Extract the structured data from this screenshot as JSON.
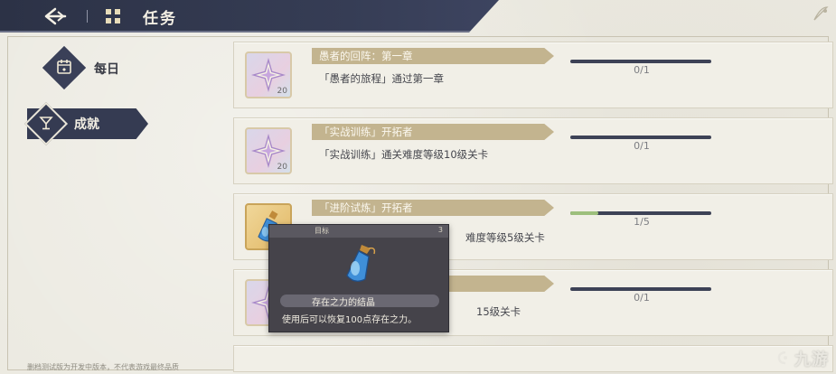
{
  "header": {
    "title": "任务",
    "back_icon": "back-arrow-icon",
    "task_icon": "task-grid-icon"
  },
  "nav": {
    "items": [
      {
        "label": "每日",
        "icon": "calendar-icon",
        "selected": false
      },
      {
        "label": "成就",
        "icon": "cup-icon",
        "selected": true
      }
    ]
  },
  "tasks": [
    {
      "title": "愚者的回阵：第一章",
      "desc": "「愚者的旅程」通过第一章",
      "progress": "0/1",
      "qty": "20",
      "item_icon": "star-crystal-icon",
      "fill": 0
    },
    {
      "title": "「实战训练」开拓者",
      "desc": "「实战训练」通关难度等级10级关卡",
      "progress": "0/1",
      "qty": "20",
      "item_icon": "star-crystal-icon",
      "fill": 0
    },
    {
      "title": "「进阶试炼」开拓者",
      "desc": "难度等级5级关卡",
      "progress": "1/5",
      "qty": "",
      "item_icon": "potion-icon",
      "fill": 0.2
    },
    {
      "title": "",
      "desc": "15级关卡",
      "progress": "0/1",
      "qty": "",
      "item_icon": "star-crystal-icon",
      "fill": 0
    }
  ],
  "tooltip": {
    "tag": "目标",
    "count": "3",
    "name": "存在之力的结晶",
    "desc": "使用后可以恢复100点存在之力。",
    "icon": "potion-icon"
  },
  "footer": {
    "note": "删档测试版为开发中版本，不代表游戏最终品质"
  },
  "watermark": {
    "text": "九游"
  },
  "colors": {
    "header_bg": "#2c3246",
    "accent_gold": "#c3b48f",
    "progress_fill": "#9dbf7c",
    "background": "#ebe9e0"
  }
}
